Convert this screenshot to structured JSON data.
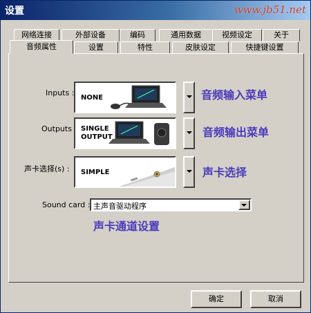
{
  "window": {
    "title": "设置",
    "watermark": "www.jb51.net"
  },
  "tabs_back": [
    "网络连接",
    "外部设备",
    "编码",
    "通用数据",
    "视频设定",
    "关于"
  ],
  "tabs_front": [
    "音频属性",
    "设置",
    "特性",
    "皮肤设定",
    "快捷键设置"
  ],
  "active_tab": "音频属性",
  "inputs": {
    "label": "Inputs :",
    "selection": "NONE",
    "annotation": "音频输入菜单"
  },
  "outputs": {
    "label": "Outputs :",
    "selection_line1": "SINGLE",
    "selection_line2": "OUTPUT",
    "annotation": "音频输出菜单"
  },
  "soundcard_select": {
    "label": "声卡选择(s) :",
    "selection": "SIMPLE",
    "annotation": "声卡选择"
  },
  "sound_card": {
    "label": "Sound card :",
    "value": "主声音驱动程序",
    "annotation": "声卡通道设置"
  },
  "buttons": {
    "ok": "确定",
    "cancel": "取消"
  },
  "colors": {
    "annotation": "#4b3bbd",
    "title_start": "#0a246a",
    "face": "#d4d0c8"
  }
}
